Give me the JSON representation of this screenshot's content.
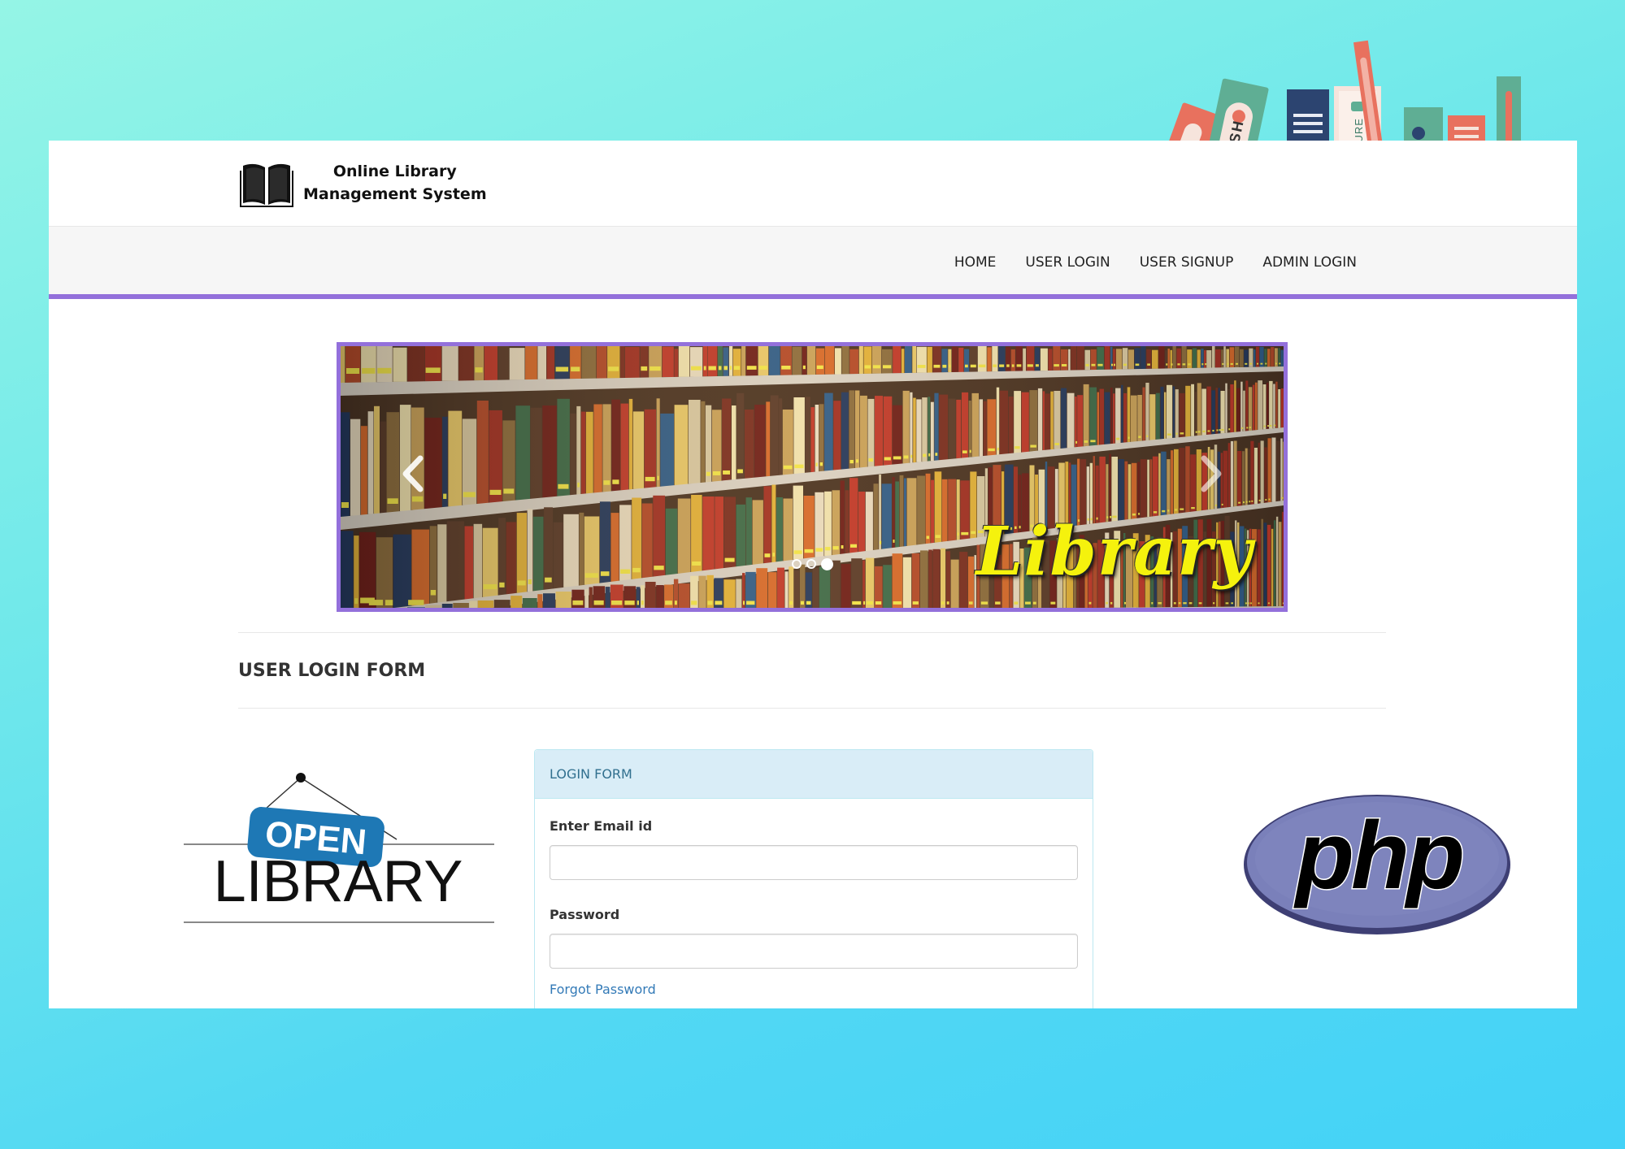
{
  "brand": {
    "line1": "Online Library",
    "line2": "Management System",
    "icon": "open-book-icon"
  },
  "nav": {
    "items": [
      {
        "label": "HOME"
      },
      {
        "label": "USER LOGIN"
      },
      {
        "label": "USER SIGNUP"
      },
      {
        "label": "ADMIN LOGIN"
      }
    ]
  },
  "carousel": {
    "caption": "Library",
    "slide_count": 3,
    "active_index": 2,
    "prev_icon": "chevron-left-icon",
    "next_icon": "chevron-right-icon"
  },
  "section": {
    "title": "USER LOGIN FORM"
  },
  "login": {
    "heading": "LOGIN FORM",
    "email_label": "Enter Email id",
    "email_value": "",
    "password_label": "Password",
    "password_value": "",
    "forgot_label": "Forgot Password"
  },
  "decor": {
    "open_sign": {
      "top": "OPEN",
      "bottom": "LIBRARY"
    },
    "php_logo": "php",
    "book_spines": [
      "ENGLISH",
      "LITERATURE"
    ]
  },
  "colors": {
    "accent": "#9370db",
    "panel_heading_bg": "#d9edf7",
    "link": "#337ab7",
    "caption_yellow": "#f5f20d"
  }
}
